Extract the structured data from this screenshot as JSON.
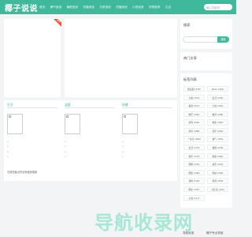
{
  "header": {
    "logo": "椰子说说",
    "nav": [
      "首页",
      "暑气追追",
      "暑假追追",
      "热播追追",
      "抖音追追",
      "热播追追",
      "小视追追",
      "好物推荐",
      "生活"
    ],
    "search_placeholder": "输入关键词"
  },
  "sidebar": {
    "search_title": "搜索",
    "search_button": "搜索",
    "hot_title": "热门文章",
    "tags_title": "标签列表",
    "tags": [
      "想追剧 (378)",
      "2021 (422)",
      "大事 (372)",
      "生活 (256)",
      "美食 (327)",
      "小说 (256)",
      "娱乐 (294)",
      "推荐 (268)",
      "游戏 (290)",
      "电影 (260)",
      "体育 (288)",
      "音乐 (256)",
      "一家亲 (266)",
      "暑气 (256)",
      "生活 (279)",
      "暑假 (256)",
      "娱乐 (273)",
      "健康 (264)",
      "刚刚 (276)",
      "资讯 (256)",
      "网络 (198)",
      "科技 (268)",
      "资料 (194)",
      "游戏 (256)",
      "明星 (187)",
      "小红书 (156)",
      "小说 (111)"
    ]
  },
  "main": {
    "ribbon": "置顶",
    "columns": [
      {
        "title": "生活"
      },
      {
        "title": "温度"
      },
      {
        "title": "热播"
      }
    ],
    "footer_text": "去到您最近有没有使用搜索"
  },
  "watermark": {
    "text": "导航收录网",
    "sub_left": "导航收录",
    "sub_right": "椰子专业导航"
  }
}
